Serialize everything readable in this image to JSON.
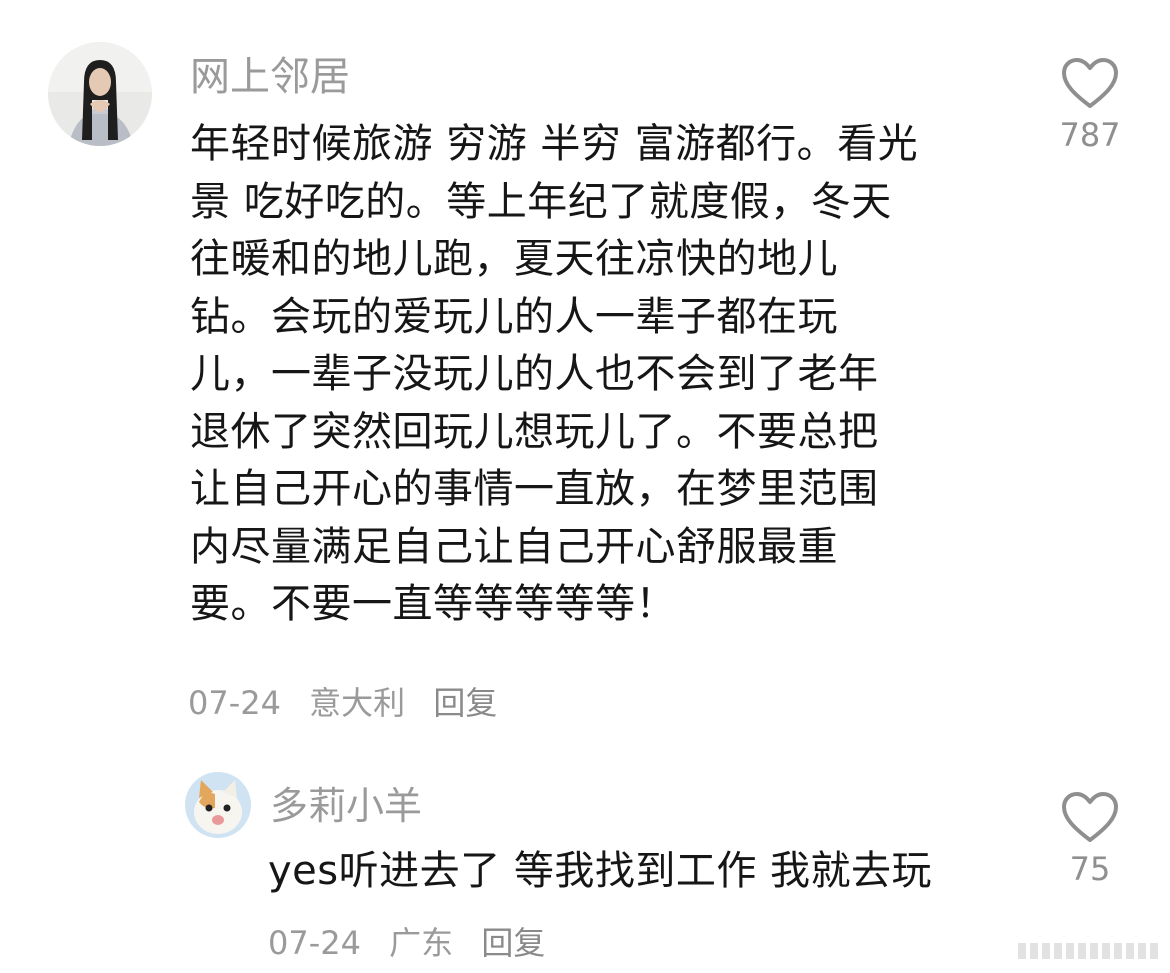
{
  "comments": [
    {
      "username": "网上邻居",
      "content": "年轻时候旅游 穷游 半穷 富游都行。看光\n景 吃好吃的。等上年纪了就度假，冬天\n往暖和的地儿跑，夏天往凉快的地儿\n钻。会玩的爱玩儿的人一辈子都在玩\n儿，一辈子没玩儿的人也不会到了老年\n退休了突然回玩儿想玩儿了。不要总把\n让自己开心的事情一直放，在梦里范围\n内尽量满足自己让自己开心舒服最重\n要。不要一直等等等等等！",
      "date": "07-24",
      "location": "意大利",
      "reply_label": "回复",
      "likes": "787",
      "like_icon": "heart-outline-icon"
    },
    {
      "username": "多莉小羊",
      "content": "yes听进去了 等我找到工作 我就去玩",
      "date": "07-24",
      "location": "广东",
      "reply_label": "回复",
      "likes": "75",
      "like_icon": "heart-outline-icon"
    }
  ],
  "colors": {
    "background": "#ffffff",
    "text": "#161616",
    "secondary_text": "#9a9a9a",
    "icon": "#8f8f8f"
  }
}
